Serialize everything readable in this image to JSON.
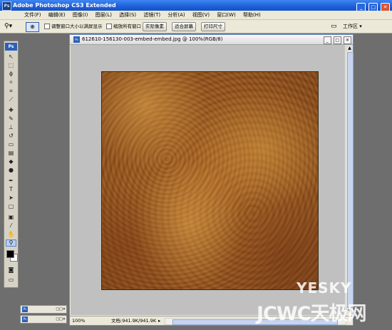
{
  "app": {
    "title": "Adobe Photoshop CS3 Extended",
    "logo_text": "Ps"
  },
  "window_controls": {
    "minimize": "_",
    "maximize": "□",
    "close": "✕"
  },
  "menubar": {
    "items": [
      {
        "label": "文件(F)"
      },
      {
        "label": "编辑(E)"
      },
      {
        "label": "图像(I)"
      },
      {
        "label": "图层(L)"
      },
      {
        "label": "选择(S)"
      },
      {
        "label": "滤镜(T)"
      },
      {
        "label": "分析(A)"
      },
      {
        "label": "视图(V)"
      },
      {
        "label": "窗口(W)"
      },
      {
        "label": "帮助(H)"
      }
    ]
  },
  "options": {
    "tool_icon": "zoom-icon",
    "resize_windows_label": "调整窗口大小以满屏显示",
    "zoom_all_label": "缩放所有窗口",
    "actual_pixels_label": "实际像素",
    "fit_screen_label": "适合屏幕",
    "print_size_label": "打印尺寸",
    "workspace_label": "工作区 ▾"
  },
  "toolbox": {
    "badge": "Ps",
    "tools": [
      {
        "name": "move-tool-icon",
        "glyph": "↖"
      },
      {
        "name": "marquee-tool-icon",
        "glyph": "⬚"
      },
      {
        "name": "lasso-tool-icon",
        "glyph": "ϕ"
      },
      {
        "name": "magic-wand-tool-icon",
        "glyph": "✧"
      },
      {
        "name": "crop-tool-icon",
        "glyph": "⌗"
      },
      {
        "name": "slice-tool-icon",
        "glyph": "⟋"
      },
      {
        "name": "healing-brush-tool-icon",
        "glyph": "✚"
      },
      {
        "name": "brush-tool-icon",
        "glyph": "✎"
      },
      {
        "name": "clone-stamp-tool-icon",
        "glyph": "⊥"
      },
      {
        "name": "history-brush-tool-icon",
        "glyph": "↺"
      },
      {
        "name": "eraser-tool-icon",
        "glyph": "▭"
      },
      {
        "name": "gradient-tool-icon",
        "glyph": "▤"
      },
      {
        "name": "blur-tool-icon",
        "glyph": "◆"
      },
      {
        "name": "dodge-tool-icon",
        "glyph": "●"
      },
      {
        "name": "pen-tool-icon",
        "glyph": "✒"
      },
      {
        "name": "type-tool-icon",
        "glyph": "T"
      },
      {
        "name": "path-selection-tool-icon",
        "glyph": "➤"
      },
      {
        "name": "shape-tool-icon",
        "glyph": "▢"
      },
      {
        "name": "notes-tool-icon",
        "glyph": "▣"
      },
      {
        "name": "eyedropper-tool-icon",
        "glyph": "⁄"
      },
      {
        "name": "hand-tool-icon",
        "glyph": "✋"
      },
      {
        "name": "zoom-tool-icon",
        "glyph": "⚲"
      }
    ],
    "extra_tools": [
      {
        "name": "quick-mask-icon",
        "glyph": "◙"
      },
      {
        "name": "screen-mode-icon",
        "glyph": "▭"
      }
    ]
  },
  "document": {
    "title": "612610-156130-003-embed-embed.jpg @ 100%(RGB/8)",
    "zoom": "100%",
    "doc_info": "文档:941.9K/941.9K",
    "status_arrow": "▸"
  },
  "minimized_docs": [
    {
      "label": "Ps"
    },
    {
      "label": "Ps"
    }
  ],
  "watermark": {
    "line1": "YESKY",
    "line2": "JCWC天极网"
  },
  "colors": {
    "titlebar": "#1d5fd9",
    "chrome": "#ece9d8",
    "workspace_bg": "#6e6e6e",
    "canvas_bg": "#c0c0c0",
    "leather": "#9c5a1f"
  }
}
